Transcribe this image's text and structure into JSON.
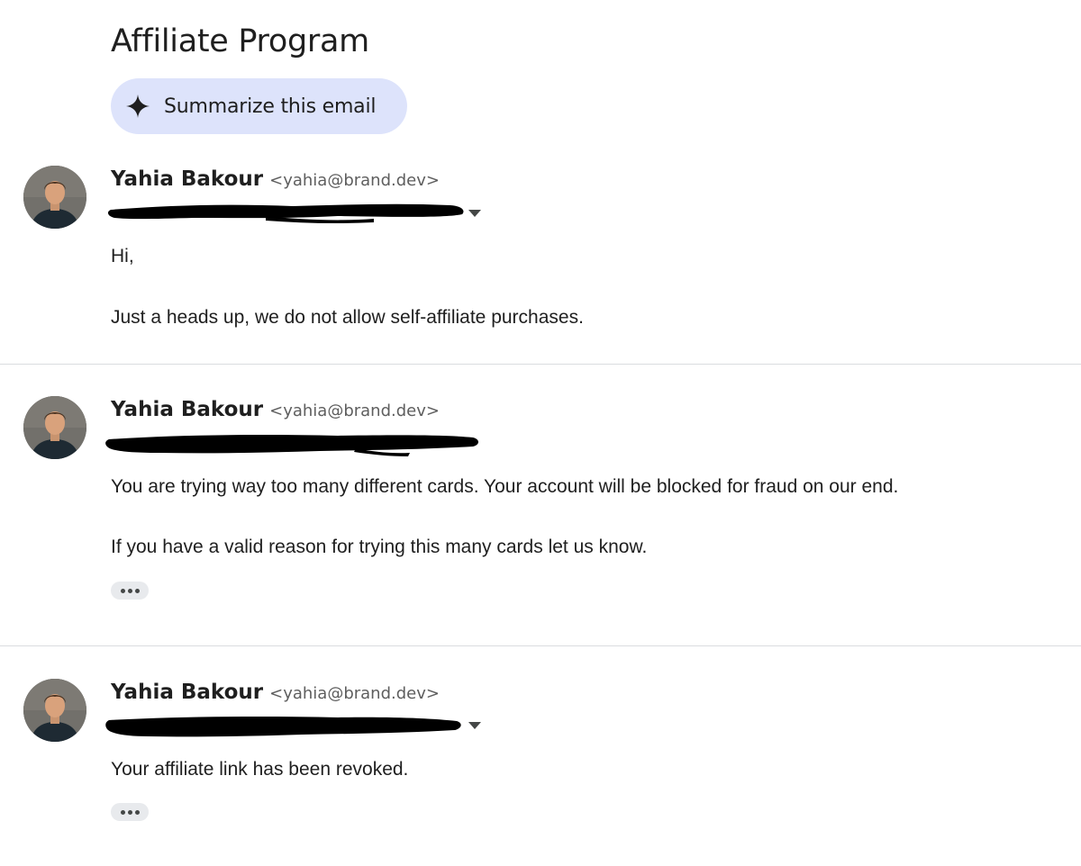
{
  "email": {
    "subject": "Affiliate Program",
    "summarize_label": "Summarize this email"
  },
  "messages": [
    {
      "sender_name": "Yahia Bakour",
      "sender_email": "<yahia@brand.dev>",
      "body": [
        "Hi,",
        "Just a heads up, we do not allow self-affiliate purchases."
      ]
    },
    {
      "sender_name": "Yahia Bakour",
      "sender_email": "<yahia@brand.dev>",
      "body": [
        "You are trying way too many different cards. Your account will be blocked for fraud on our end.",
        "If you have a valid reason for trying this many cards let us know."
      ]
    },
    {
      "sender_name": "Yahia Bakour",
      "sender_email": "<yahia@brand.dev>",
      "body": [
        "Your affiliate link has been revoked."
      ]
    }
  ],
  "icons": {
    "summarize": "sparkle-icon",
    "details": "chevron-down-icon",
    "more": "more-horizontal-icon"
  }
}
